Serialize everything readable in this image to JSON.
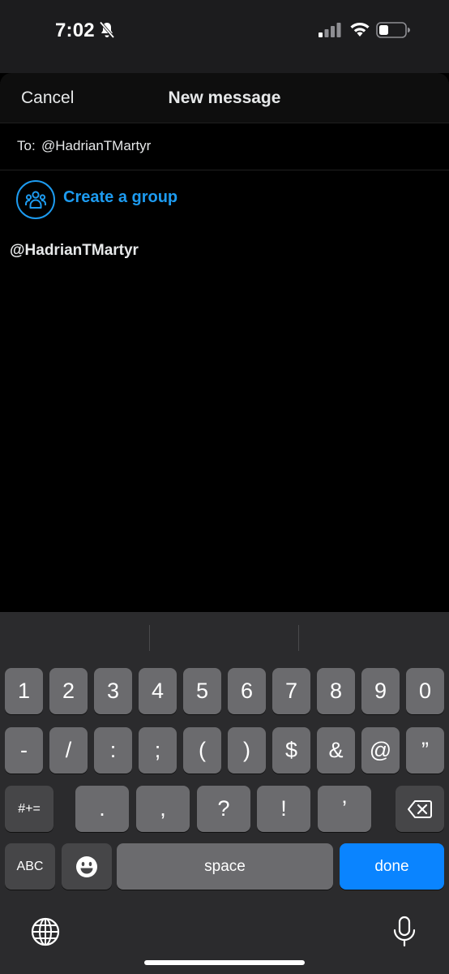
{
  "status_bar": {
    "time": "7:02",
    "icons": [
      "bell-slash-icon",
      "cellular-signal-icon",
      "wifi-icon",
      "battery-icon"
    ]
  },
  "nav": {
    "cancel_label": "Cancel",
    "title": "New message"
  },
  "recipient": {
    "to_label": "To:",
    "value": "@HadrianTMartyr"
  },
  "create_group": {
    "icon": "group-icon",
    "label": "Create a group"
  },
  "results": [
    {
      "handle": "@HadrianTMartyr"
    }
  ],
  "keyboard": {
    "row1": [
      "1",
      "2",
      "3",
      "4",
      "5",
      "6",
      "7",
      "8",
      "9",
      "0"
    ],
    "row2": [
      "-",
      "/",
      ":",
      ";",
      "(",
      ")",
      "$",
      "&",
      "@",
      "”"
    ],
    "row3_left": "#+=",
    "row3": [
      ".",
      ",",
      "?",
      "!",
      "’"
    ],
    "row3_right_icon": "backspace-icon",
    "abc_label": "ABC",
    "emoji_icon": "emoji-icon",
    "space_label": "space",
    "done_label": "done",
    "globe_icon": "globe-icon",
    "mic_icon": "microphone-icon"
  },
  "colors": {
    "accent": "#1d9bf0",
    "done_key": "#0a84ff",
    "keyboard_bg": "#2b2b2d",
    "key": "#6b6b6e",
    "function_key": "#464648"
  }
}
